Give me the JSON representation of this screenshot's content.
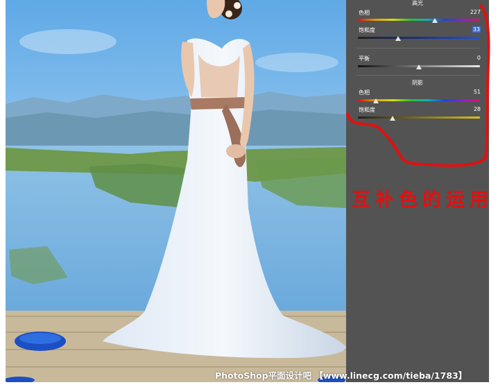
{
  "panel": {
    "highlights": {
      "title": "高光",
      "hue_label": "色相",
      "hue_value": "227",
      "saturation_label": "饱和度",
      "saturation_value": "33"
    },
    "balance": {
      "label": "平衡",
      "value": "0"
    },
    "shadows": {
      "title": "阴影",
      "hue_label": "色相",
      "hue_value": "51",
      "saturation_label": "饱和度",
      "saturation_value": "28"
    }
  },
  "caption": "互补色的运用",
  "watermark": "PhotoShop平面设计吧 【www.linecg.com/tieba/1783】",
  "colors": {
    "panel_bg": "#535353",
    "annotation_red": "#e21010",
    "selection_blue": "#3b6fd6"
  }
}
